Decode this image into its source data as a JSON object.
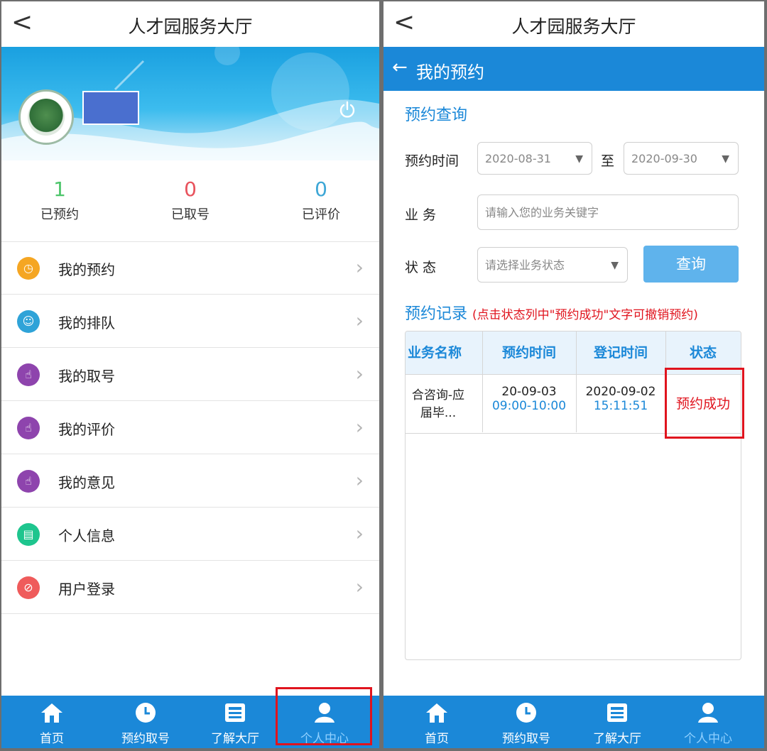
{
  "left": {
    "nav": {
      "back": "<",
      "title": "人才园服务大厅"
    },
    "stats": [
      {
        "value": "1",
        "label": "已预约",
        "color": "#4cc56a"
      },
      {
        "value": "0",
        "label": "已取号",
        "color": "#e8535d"
      },
      {
        "value": "0",
        "label": "已评价",
        "color": "#3ea7d6"
      }
    ],
    "menu": [
      {
        "label": "我的预约",
        "icon": "clock-icon",
        "color": "#f5a623"
      },
      {
        "label": "我的排队",
        "icon": "people-icon",
        "color": "#2fa3d8"
      },
      {
        "label": "我的取号",
        "icon": "tap-icon",
        "color": "#8e44ad"
      },
      {
        "label": "我的评价",
        "icon": "tap-icon",
        "color": "#8e44ad"
      },
      {
        "label": "我的意见",
        "icon": "tap-icon",
        "color": "#8e44ad"
      },
      {
        "label": "个人信息",
        "icon": "document-icon",
        "color": "#1ec58e"
      },
      {
        "label": "用户登录",
        "icon": "compass-icon",
        "color": "#ef5b5b"
      }
    ]
  },
  "tabs": [
    {
      "label": "首页",
      "icon": "home-icon"
    },
    {
      "label": "预约取号",
      "icon": "clock-icon"
    },
    {
      "label": "了解大厅",
      "icon": "news-icon"
    },
    {
      "label": "个人中心",
      "icon": "person-icon"
    }
  ],
  "right": {
    "nav": {
      "back": "<",
      "title": "人才园服务大厅"
    },
    "subbar": {
      "arrow": "←",
      "title": "我的预约"
    },
    "query_title": "预约查询",
    "time_label": "预约时间",
    "date_from": "2020-08-31",
    "to_label": "至",
    "date_to": "2020-09-30",
    "service_label": "业 务",
    "service_placeholder": "请输入您的业务关键字",
    "status_label": "状 态",
    "status_placeholder": "请选择业务状态",
    "query_button": "查询",
    "records_title": "预约记录",
    "records_note": "(点击状态列中\"预约成功\"文字可撤销预约)",
    "columns": [
      "业务名称",
      "预约时间",
      "登记时间",
      "状态"
    ],
    "row": {
      "name_l1": "合咨询-应",
      "name_l2": "届毕...",
      "appt_date": "20-09-03",
      "appt_time": "09:00-10:00",
      "reg_date": "2020-09-02",
      "reg_time": "15:11:51",
      "status": "预约成功"
    }
  },
  "colors": {
    "accent": "#1b88d8",
    "highlight": "#e0141e"
  }
}
